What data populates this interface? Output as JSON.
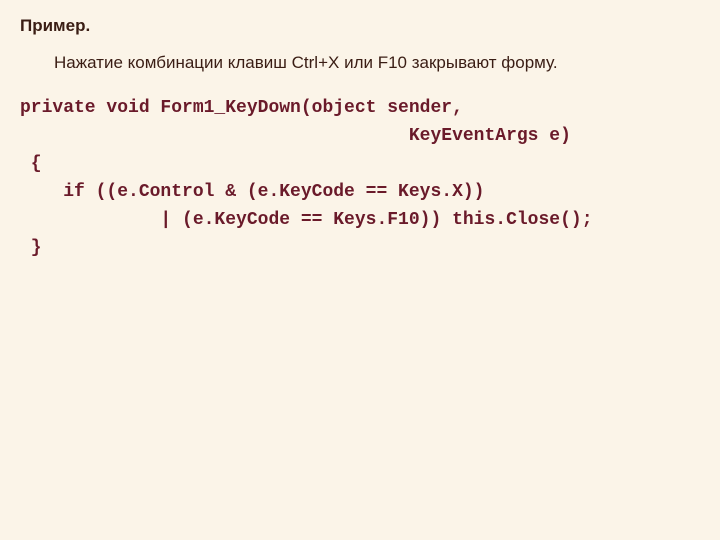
{
  "heading": "Пример.",
  "paragraph": "Нажатие комбинации клавиш Ctrl+X или F10 закрывают форму.",
  "code": "private void Form1_KeyDown(object sender,\n                                    KeyEventArgs e)\n {\n    if ((e.Control & (e.KeyCode == Keys.X))\n             | (e.KeyCode == Keys.F10)) this.Close();\n }"
}
